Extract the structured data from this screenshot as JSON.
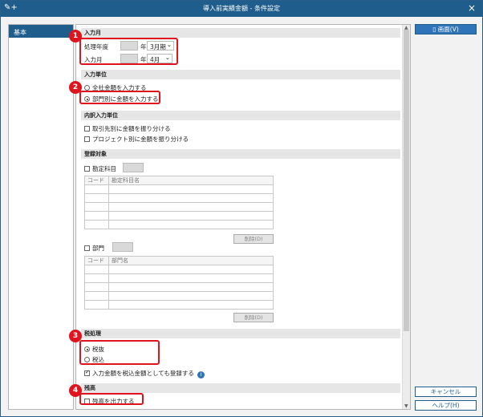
{
  "window": {
    "title": "導入前実績金額 - 条件設定",
    "close": "×",
    "app_icon": "✎+"
  },
  "sidebar": {
    "items": [
      {
        "label": "基本"
      }
    ]
  },
  "side_buttons": {
    "screen": "画面(V)",
    "cancel": "キャンセル",
    "help": "ヘルプ(H)"
  },
  "badges": [
    "1",
    "2",
    "3",
    "4"
  ],
  "sections": {
    "input_month": {
      "title": "入力月",
      "fiscal_year_label": "処理年度",
      "fiscal_year_suffix": "年",
      "fiscal_period_value": "3月期",
      "month_label": "入力月",
      "month_suffix": "年",
      "month_value": "4月",
      "dropdown_arrow": "⌄"
    },
    "input_unit": {
      "title": "入力単位",
      "option_company": "全社金額を入力する",
      "option_department": "部門別に金額を入力する",
      "selected": "option_department"
    },
    "breakdown_unit": {
      "title": "内訳入力単位",
      "option_supplier": "取引先別に金額を振り分ける",
      "option_project": "プロジェクト別に金額を振り分ける"
    },
    "registration_target": {
      "title": "登録対象",
      "account_label": "勘定科目",
      "account_table": {
        "col_code": "コード",
        "col_name": "勘定科目名"
      },
      "delete_button": "削除(D)",
      "department_label": "部門",
      "department_table": {
        "col_code": "コード",
        "col_name": "部門名"
      },
      "delete_button2": "削除(D)"
    },
    "tax": {
      "title": "税処理",
      "option_excluded": "税抜",
      "option_included": "税込",
      "selected": "option_excluded",
      "register_tax_included": "入力金額を税込金額としても登録する",
      "register_checked": true,
      "info_icon": "i"
    },
    "balance": {
      "title": "残高",
      "output_balance": "残高を出力する"
    }
  }
}
